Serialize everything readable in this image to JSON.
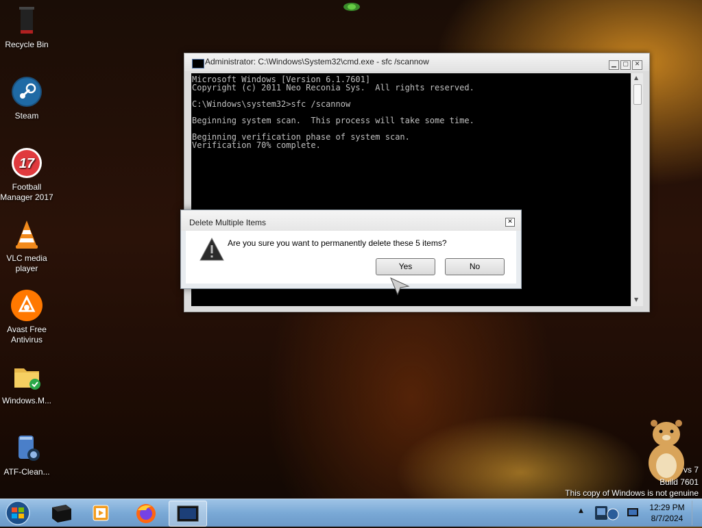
{
  "desktop": {
    "icons": [
      {
        "label": "Recycle Bin"
      },
      {
        "label": "Steam"
      },
      {
        "label": "Football\nManager 2017"
      },
      {
        "label": "VLC media\nplayer"
      },
      {
        "label": "Avast Free\nAntivirus"
      },
      {
        "label": "Windows.M..."
      },
      {
        "label": "ATF-Clean..."
      }
    ],
    "football_manager_badge": "17"
  },
  "cmd_window": {
    "title": "Administrator: C:\\Windows\\System32\\cmd.exe - sfc  /scannow",
    "lines": "Microsoft Windows [Version 6.1.7601]\nCopyright (c) 2011 Neo Reconia Sys.  All rights reserved.\n\nC:\\Windows\\system32>sfc /scannow\n\nBeginning system scan.  This process will take some time.\n\nBeginning verification phase of system scan.\nVerification 70% complete.",
    "minimize_glyph": "▁",
    "maximize_glyph": "▢",
    "close_glyph": "✕"
  },
  "dialog": {
    "title": "Delete Multiple Items",
    "message": "Are you sure you want to permanently delete these 5 items?",
    "yes_label": "Yes",
    "no_label": "No",
    "close_glyph": "✕"
  },
  "watermark": {
    "line1": "vs 7",
    "line2": "Build 7601",
    "line3": "This copy of Windows is not genuine"
  },
  "taskbar": {
    "time": "12:29 PM",
    "date": "8/7/2024",
    "tray_arrow": "▲"
  },
  "colors": {
    "taskbar": "#7aa9d6",
    "console_bg": "#000000",
    "console_text": "#c0c0c0"
  }
}
